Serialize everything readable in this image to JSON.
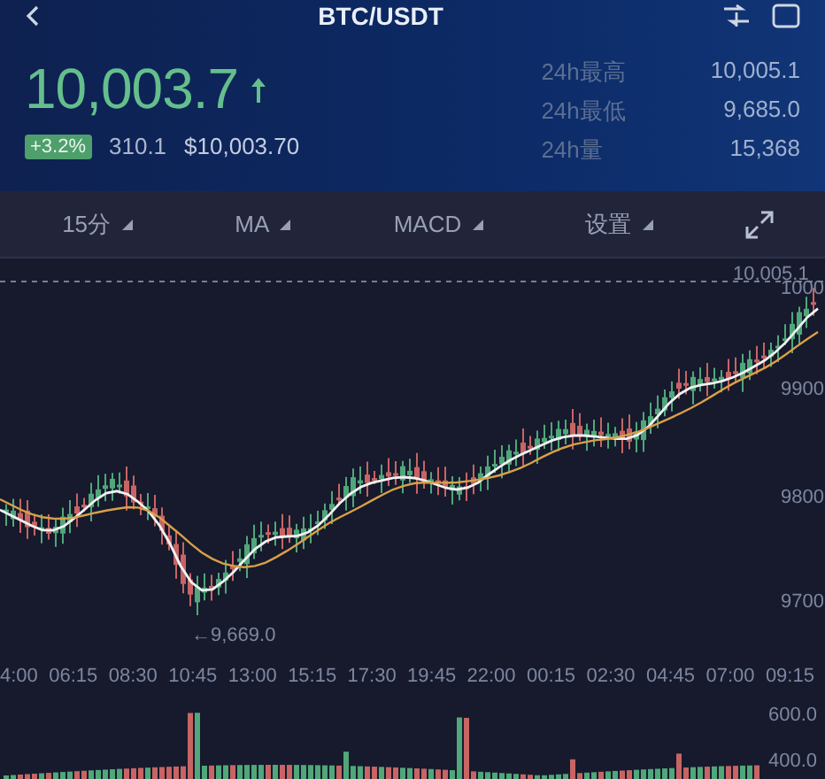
{
  "header": {
    "title": "BTC/USDT",
    "price": "10,003.7",
    "change_badge": "+3.2%",
    "change_amount": "310.1",
    "price_usd": "$10,003.70",
    "stats": [
      {
        "label": "24h最高",
        "value": "10,005.1"
      },
      {
        "label": "24h最低",
        "value": "9,685.0"
      },
      {
        "label": "24h量",
        "value": "15,368"
      }
    ]
  },
  "toolbar": {
    "items": [
      "15分",
      "MA",
      "MACD",
      "设置"
    ]
  },
  "chart": {
    "high_marker": "10,005.1",
    "low_marker": "←9,669.0",
    "y_labels": [
      "1000",
      "9900",
      "9800",
      "9700"
    ],
    "x_labels": [
      "4:00",
      "06:15",
      "08:30",
      "10:45",
      "13:00",
      "15:15",
      "17:30",
      "19:45",
      "22:00",
      "00:15",
      "02:30",
      "04:45",
      "07:00",
      "09:15"
    ],
    "volume_labels": [
      "600.0",
      "400.0"
    ]
  }
}
